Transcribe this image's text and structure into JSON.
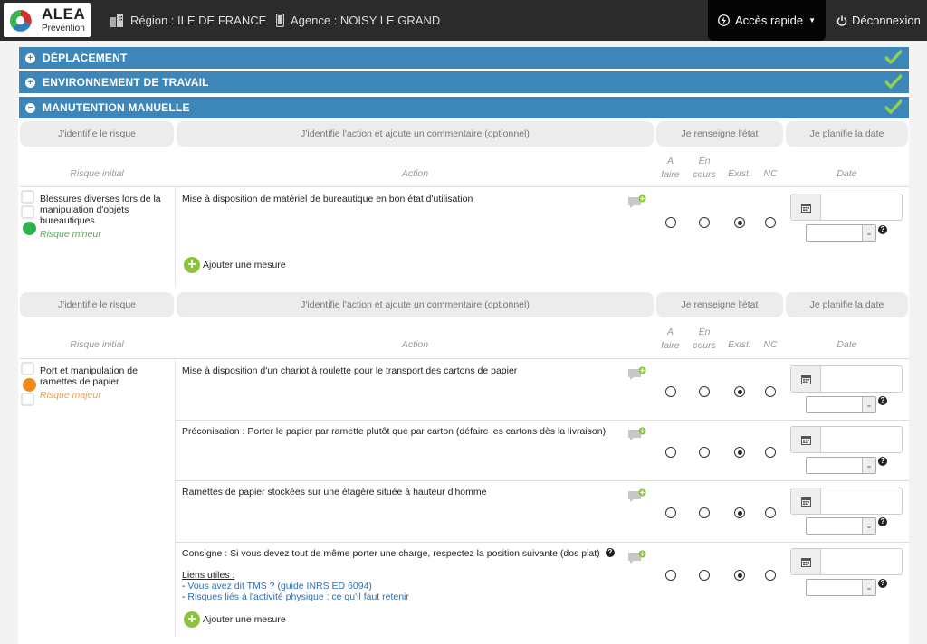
{
  "header": {
    "logo_title": "ALEA",
    "logo_sub": "Prevention",
    "region": "Région : ILE DE FRANCE",
    "agence": "Agence : NOISY LE GRAND",
    "quick_access": "Accès rapide",
    "logout": "Déconnexion"
  },
  "sections": [
    {
      "label": "DÉPLACEMENT",
      "icon": "plus"
    },
    {
      "label": "ENVIRONNEMENT DE TRAVAIL",
      "icon": "plus"
    },
    {
      "label": "MANUTENTION MANUELLE",
      "icon": "minus"
    }
  ],
  "table_headers": {
    "risk": "J'identifie le risque",
    "action": "J'identifie l'action et ajoute un commentaire (optionnel)",
    "state": "Je renseigne l'état",
    "date": "Je planifie la date"
  },
  "subheaders": {
    "initial_risk": "Risque initial",
    "action": "Action",
    "a_faire_1": "A",
    "a_faire_2": "faire",
    "en_cours_1": "En",
    "en_cours_2": "cours",
    "exist": "Exist.",
    "nc": "NC",
    "date": "Date"
  },
  "risk1": {
    "text_l1": "Blessures diverses lors de la",
    "text_l2": "manipulation d'objets",
    "text_l3": "bureautiques",
    "level": "Risque mineur",
    "level_color": "#2eb24a",
    "actions": [
      "Mise à disposition de matériel de bureautique en bon état d'utilisation"
    ]
  },
  "risk2": {
    "text_l1": "Port et manipulation de",
    "text_l2": "ramettes de papier",
    "level": "Risque majeur",
    "level_color": "#f28a1a",
    "actions": [
      "Mise à disposition d'un chariot à roulette pour le transport des cartons de papier",
      "Préconisation : Porter le papier par ramette plutôt que par carton (défaire les cartons dès la livraison)",
      "Ramettes de papier stockées sur une étagère située à hauteur d'homme",
      "Consigne : Si vous devez tout de même porter une charge, respectez la position suivante (dos plat)"
    ]
  },
  "useful_links": {
    "title": "Liens utiles :",
    "links": [
      "Vous avez dit TMS ? (guide INRS ED 6094)",
      "Risques liés à l'activité physique : ce qu'il faut retenir"
    ]
  },
  "add_measure": "Ajouter une mesure"
}
